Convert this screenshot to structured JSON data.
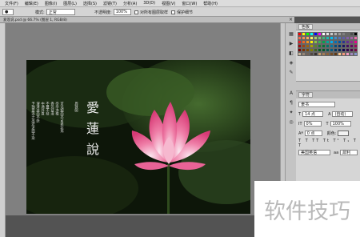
{
  "menubar": {
    "items": [
      "文件(F)",
      "编辑(E)",
      "图像(I)",
      "图层(L)",
      "选择(S)",
      "滤镜(T)",
      "分析(A)",
      "3D(D)",
      "视图(V)",
      "窗口(W)",
      "帮助(H)"
    ]
  },
  "options": {
    "mode_label": "模式:",
    "mode_value": "正常",
    "opacity_label": "不透明度:",
    "opacity_value": "100%",
    "sample_all_label": "对所有图层取样",
    "protect_label": "保护细节"
  },
  "document": {
    "tab_title": "爱莲说.psd @ 66.7% (图层 1, RGB/8)",
    "body_text": [
      "予独爱莲之出淤泥而不染",
      "濯清涟而不妖",
      "中通外直",
      "不蔓不枝",
      "香远益清",
      "亭亭净植",
      "可远观而不可亵玩焉"
    ],
    "signature": "周敦颐",
    "title_chars": [
      "愛",
      "蓮",
      "說"
    ]
  },
  "panels": {
    "swatches_tab": "色板",
    "character_tab": "字符",
    "font_value": "隶书",
    "size_value": "14 点",
    "leading_value": "(自动)",
    "scale_v": "0%",
    "scale_h": "100%",
    "baseline": "0 点",
    "color_label": "颜色:",
    "lang_value": "美国英语",
    "aa_value": "犀利"
  },
  "colors": {
    "menubar_bg": "#dcdcdc",
    "canvas_bg": "#808080",
    "lotus_pink": "#e8598f",
    "title_text": "#eeeeee"
  },
  "watermark": {
    "text": "软件技巧"
  }
}
